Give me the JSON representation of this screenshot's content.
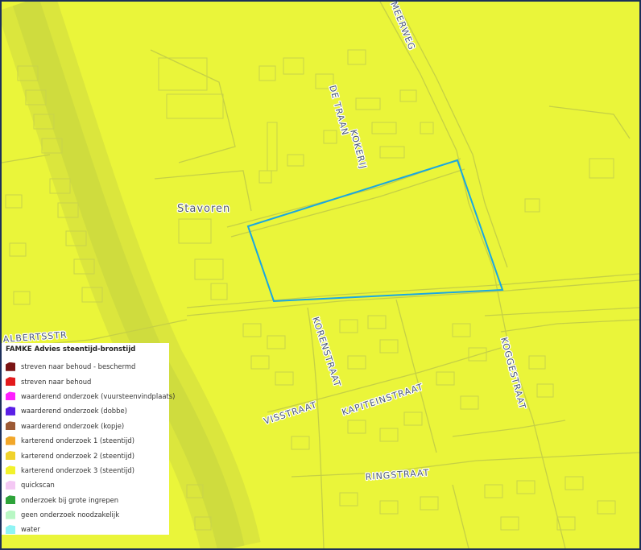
{
  "map": {
    "background_color": "#eaf53a",
    "outline_color": "#1aa7e0",
    "place_label": "Stavoren",
    "streets": [
      "MEERWEG",
      "DE TRAAN",
      "KOKERIJ",
      "ALBERTSSTR",
      "KORENSTRAAT",
      "VISSTRAAT",
      "KAPITEINSTRAAT",
      "KOGGESTRAAT",
      "RINGSTRAAT"
    ]
  },
  "legend": {
    "title": "FAMKE Advies steentijd-bronstijd",
    "items": [
      {
        "label": "streven naar behoud - beschermd",
        "color": "#7a1414"
      },
      {
        "label": "streven naar behoud",
        "color": "#e31a1c"
      },
      {
        "label": "waarderend onderzoek (vuursteenvindplaats)",
        "color": "#ff1fff"
      },
      {
        "label": "waarderend onderzoek (dobbe)",
        "color": "#5a1fe6"
      },
      {
        "label": "waarderend onderzoek (kopje)",
        "color": "#9c5a35"
      },
      {
        "label": "karterend onderzoek 1 (steentijd)",
        "color": "#f2a72a"
      },
      {
        "label": "karterend onderzoek 2 (steentijd)",
        "color": "#f0d22c"
      },
      {
        "label": "karterend onderzoek 3 (steentijd)",
        "color": "#f2f22c"
      },
      {
        "label": "quickscan",
        "color": "#f4c8f4"
      },
      {
        "label": "onderzoek bij grote ingrepen",
        "color": "#2ea33a"
      },
      {
        "label": "geen onderzoek noodzakelijk",
        "color": "#b8f7c4"
      },
      {
        "label": "water",
        "color": "#8ff4f4"
      }
    ]
  }
}
